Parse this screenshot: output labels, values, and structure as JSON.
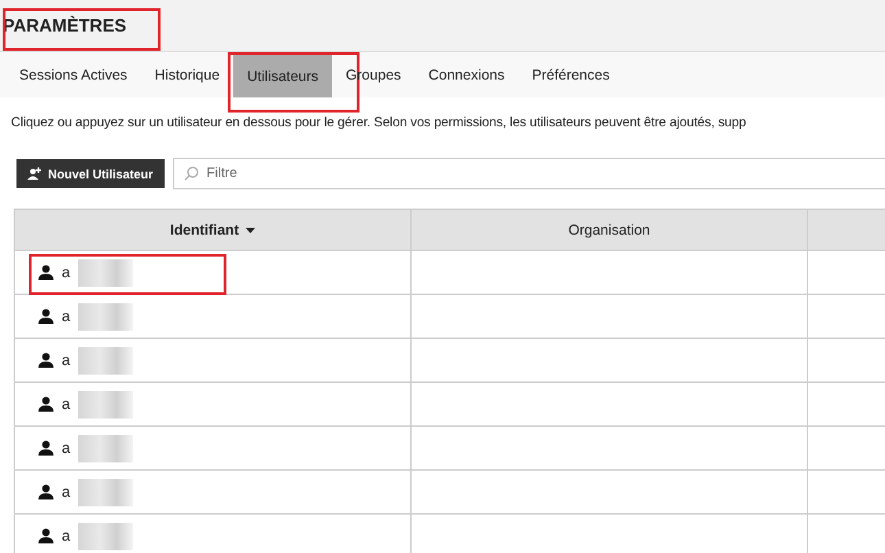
{
  "title": "PARAMÈTRES",
  "tabs": [
    {
      "label": "Sessions Actives",
      "selected": false
    },
    {
      "label": "Historique",
      "selected": false
    },
    {
      "label": "Utilisateurs",
      "selected": true
    },
    {
      "label": "Groupes",
      "selected": false
    },
    {
      "label": "Connexions",
      "selected": false
    },
    {
      "label": "Préférences",
      "selected": false
    }
  ],
  "description": "Cliquez ou appuyez sur un utilisateur en dessous pour le gérer. Selon vos permissions, les utilisateurs peuvent être ajoutés, supp",
  "new_user_button": "Nouvel Utilisateur",
  "filter": {
    "placeholder": "Filtre"
  },
  "table": {
    "columns": [
      {
        "label": "Identifiant",
        "sorted": true
      },
      {
        "label": "Organisation",
        "sorted": false
      },
      {
        "sorted": false
      }
    ],
    "rows": [
      {
        "username": "a"
      },
      {
        "username": "a"
      },
      {
        "username": "a"
      },
      {
        "username": "a"
      },
      {
        "username": "a"
      },
      {
        "username": "a"
      },
      {
        "username": "a"
      }
    ]
  }
}
